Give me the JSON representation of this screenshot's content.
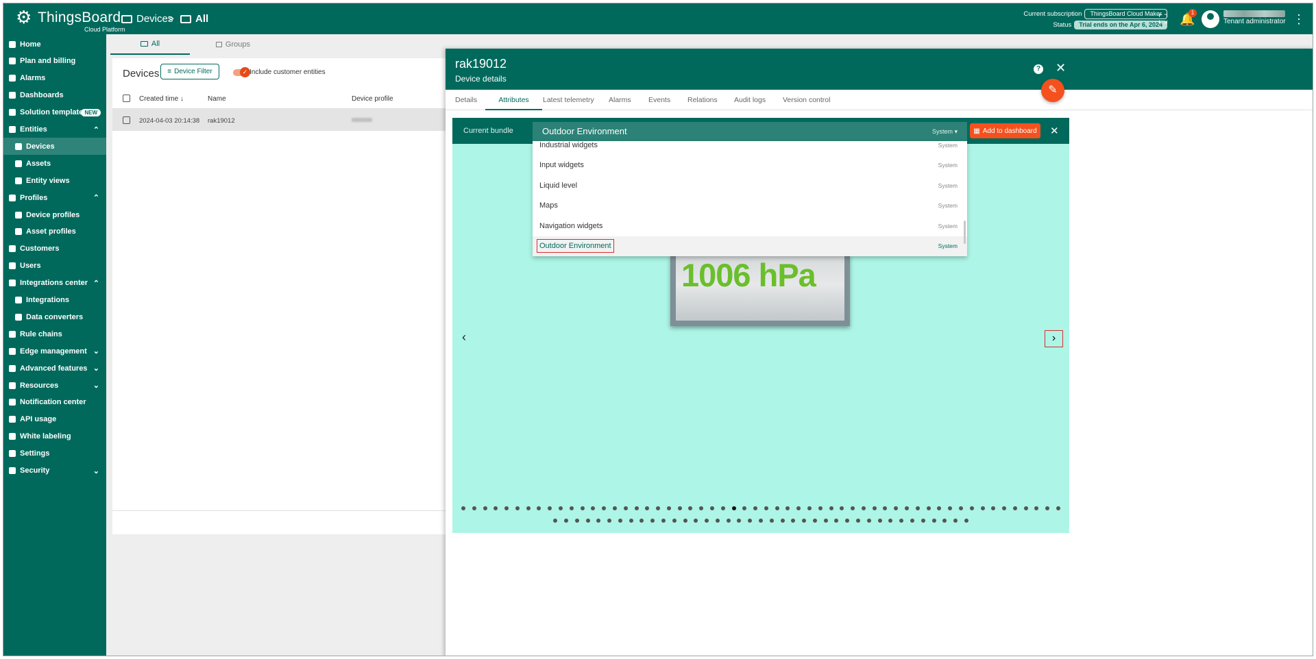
{
  "app": {
    "name": "ThingsBoard",
    "subtitle": "Cloud Platform"
  },
  "breadcrumb": {
    "first": "Devices",
    "separator": ">",
    "second": "All"
  },
  "subscription": {
    "label": "Current subscription",
    "plan": "ThingsBoard Cloud Maker",
    "status_label": "Status",
    "status": "Trial ends on the Apr 6, 2024"
  },
  "notifications": {
    "count": "1"
  },
  "user": {
    "role": "Tenant administrator"
  },
  "colors": {
    "primary": "#00695c",
    "accent": "#f4511e",
    "selection": "#d32f2f",
    "bundle_bg": "#adf5e6"
  },
  "sidebar": {
    "items": [
      {
        "label": "Home",
        "icon": "home-icon"
      },
      {
        "label": "Plan and billing",
        "icon": "billing-icon"
      },
      {
        "label": "Alarms",
        "icon": "alarm-icon"
      },
      {
        "label": "Dashboards",
        "icon": "dashboard-icon"
      },
      {
        "label": "Solution templates",
        "icon": "templates-icon",
        "badge": "NEW"
      },
      {
        "label": "Entities",
        "icon": "entities-icon",
        "chevron": "up"
      },
      {
        "label": "Devices",
        "icon": "devices-icon",
        "child": true,
        "active": true
      },
      {
        "label": "Assets",
        "icon": "assets-icon",
        "child": true
      },
      {
        "label": "Entity views",
        "icon": "entity-views-icon",
        "child": true
      },
      {
        "label": "Profiles",
        "icon": "profiles-icon",
        "chevron": "up"
      },
      {
        "label": "Device profiles",
        "icon": "device-profile-icon",
        "child": true
      },
      {
        "label": "Asset profiles",
        "icon": "asset-profile-icon",
        "child": true
      },
      {
        "label": "Customers",
        "icon": "customers-icon"
      },
      {
        "label": "Users",
        "icon": "users-icon"
      },
      {
        "label": "Integrations center",
        "icon": "integrations-center-icon",
        "chevron": "up"
      },
      {
        "label": "Integrations",
        "icon": "integrations-icon",
        "child": true
      },
      {
        "label": "Data converters",
        "icon": "data-converters-icon",
        "child": true
      },
      {
        "label": "Rule chains",
        "icon": "rule-chains-icon"
      },
      {
        "label": "Edge management",
        "icon": "edge-icon",
        "chevron": "down"
      },
      {
        "label": "Advanced features",
        "icon": "advanced-icon",
        "chevron": "down"
      },
      {
        "label": "Resources",
        "icon": "resources-icon",
        "chevron": "down"
      },
      {
        "label": "Notification center",
        "icon": "notification-center-icon"
      },
      {
        "label": "API usage",
        "icon": "api-usage-icon"
      },
      {
        "label": "White labeling",
        "icon": "white-labeling-icon"
      },
      {
        "label": "Settings",
        "icon": "settings-icon"
      },
      {
        "label": "Security",
        "icon": "security-icon",
        "chevron": "down"
      }
    ]
  },
  "content_tabs": [
    {
      "label": "All"
    },
    {
      "label": "Groups"
    }
  ],
  "devices_list": {
    "title": "Devices",
    "filter_label": "Device Filter",
    "toggle_label": "Include customer entities",
    "columns": [
      "Created time",
      "Name",
      "Device profile"
    ],
    "rows": [
      {
        "created": "2024-04-03 20:14:38",
        "name": "rak19012"
      }
    ]
  },
  "details": {
    "title": "rak19012",
    "subtitle": "Device details",
    "tabs": [
      "Details",
      "Attributes",
      "Latest telemetry",
      "Alarms",
      "Events",
      "Relations",
      "Audit logs",
      "Version control"
    ],
    "active_tab": "Attributes",
    "bundle": {
      "label": "Current bundle",
      "selected": "Outdoor Environment",
      "selected_scope": "System",
      "add_label": "Add to dashboard",
      "options": [
        {
          "name": "Industrial widgets",
          "scope": "System"
        },
        {
          "name": "Input widgets",
          "scope": "System"
        },
        {
          "name": "Liquid level",
          "scope": "System"
        },
        {
          "name": "Maps",
          "scope": "System"
        },
        {
          "name": "Navigation widgets",
          "scope": "System"
        },
        {
          "name": "Outdoor Environment",
          "scope": "System",
          "selected": true
        }
      ],
      "widget_value": "1006 hPa",
      "pager": {
        "row1_dots": 56,
        "row2_dots": 39,
        "current": 25
      }
    }
  }
}
